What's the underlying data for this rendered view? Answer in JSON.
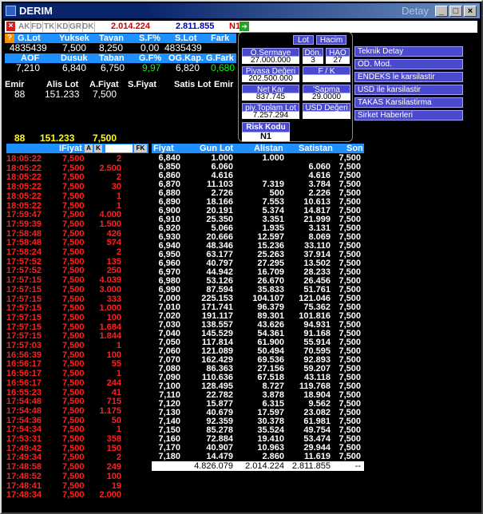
{
  "window": {
    "title": "DERIM",
    "right_label": "Detay"
  },
  "toolbar": {
    "tabs": [
      "AK",
      "FD",
      "TK",
      "KD",
      "GR",
      "DK"
    ],
    "value1": "2.014.224",
    "value2": "2.811.855",
    "n1": "N1"
  },
  "summary": {
    "row1_headers": [
      "G.Lot",
      "Yuksek",
      "Tavan",
      "S.F%",
      "S.Lot",
      "Fark"
    ],
    "row1_values": [
      "4835439",
      "7,500",
      "8,250",
      "0,00",
      "4835439",
      ""
    ],
    "row2_headers": [
      "AOF",
      "Dusuk",
      "Taban",
      "G.F%",
      "OG.Kap.",
      "G.Fark"
    ],
    "row2_values": [
      "7,210",
      "6,840",
      "6,750",
      "9,97",
      "6,820",
      "0,680"
    ],
    "row3_headers": [
      "Emir",
      "Alis Lot",
      "A.Fiyat",
      "S.Fiyat",
      "Satis Lot",
      "Emir"
    ],
    "row3_values": [
      "88",
      "151.233",
      "7,500",
      "",
      "",
      ""
    ],
    "row4_values": [
      "88",
      "151.233",
      "7,500"
    ]
  },
  "popup": {
    "lot_btn": "Lot",
    "hacim_btn": "Hacim",
    "osermaye_label": "Ö.Sermaye",
    "osermaye_value": "27.000.000",
    "don_label": "Dön.",
    "don_value": "3",
    "hao_label": "HAO",
    "hao_value": "27",
    "piyasa_label": "Piyasa Değeri",
    "piyasa_value": "202.500.000",
    "fk_label": "F / K",
    "fk_value": "",
    "netkar_label": "Net Kar",
    "netkar_value": "837.745",
    "sapma_label": "'Sapma",
    "sapma_value": "29.0000",
    "toplamlot_label": "piy.Toplam Lot",
    "toplamlot_value": "7.257.294",
    "usd_label": "USD Değeri",
    "usd_value": "",
    "risk_label": "Risk Kodu",
    "risk_value": "N1"
  },
  "menu": [
    "Teknik Detay",
    "OD. Mod.",
    "ENDEKS le karsilastir",
    "USD ile karsilastir",
    "TAKAS Karsilastirma",
    "Sirket Haberleri"
  ],
  "trades_header": {
    "fiyat": "IFiyat",
    "a": "A",
    "k": "K",
    "fk": "FK"
  },
  "trades": [
    [
      "18:05:22",
      "7,500",
      "2"
    ],
    [
      "18:05:22",
      "7,500",
      "2.500"
    ],
    [
      "18:05:22",
      "7,500",
      "2"
    ],
    [
      "18:05:22",
      "7,500",
      "30"
    ],
    [
      "18:05:22",
      "7,500",
      "1"
    ],
    [
      "18:05:22",
      "7,500",
      "1"
    ],
    [
      "17:59:47",
      "7,500",
      "4.000"
    ],
    [
      "17:59:39",
      "7,500",
      "1.500"
    ],
    [
      "17:58:48",
      "7,500",
      "426"
    ],
    [
      "17:58:48",
      "7,500",
      "574"
    ],
    [
      "17:58:24",
      "7,500",
      "2"
    ],
    [
      "17:57:52",
      "7,500",
      "135"
    ],
    [
      "17:57:52",
      "7,500",
      "250"
    ],
    [
      "17:57:15",
      "7,500",
      "4.039"
    ],
    [
      "17:57:15",
      "7,500",
      "3.000"
    ],
    [
      "17:57:15",
      "7,500",
      "333"
    ],
    [
      "17:57:15",
      "7,500",
      "1.000"
    ],
    [
      "17:57:15",
      "7,500",
      "100"
    ],
    [
      "17:57:15",
      "7,500",
      "1.684"
    ],
    [
      "17:57:15",
      "7,500",
      "1.844"
    ],
    [
      "17:57:03",
      "7,500",
      "1"
    ],
    [
      "16:56:39",
      "7,500",
      "100"
    ],
    [
      "16:56:17",
      "7,500",
      "55"
    ],
    [
      "16:56:17",
      "7,500",
      "1"
    ],
    [
      "16:56:17",
      "7,500",
      "244"
    ],
    [
      "16:55:23",
      "7,500",
      "41"
    ],
    [
      "17:54:48",
      "7,500",
      "715"
    ],
    [
      "17:54:48",
      "7,500",
      "1.175"
    ],
    [
      "17:54:36",
      "7,500",
      "50"
    ],
    [
      "17:54:34",
      "7,500",
      "1"
    ],
    [
      "17:53:31",
      "7,500",
      "358"
    ],
    [
      "17:49:42",
      "7,500",
      "150"
    ],
    [
      "17:49:34",
      "7,500",
      "2"
    ],
    [
      "17:48:58",
      "7,500",
      "249"
    ],
    [
      "17:48:52",
      "7,500",
      "100"
    ],
    [
      "17:48:41",
      "7,500",
      "19"
    ],
    [
      "17:48:34",
      "7,500",
      "2.000"
    ]
  ],
  "depth_header": {
    "fiyat": "Fiyat",
    "gun_lot": "Gun Lot",
    "alistan": "Alistan",
    "satistan": "Satistan",
    "son": "Son"
  },
  "depth": [
    [
      "6,840",
      "1.000",
      "1.000",
      "",
      "7,500"
    ],
    [
      "6,850",
      "6.060",
      "",
      "6.060",
      "7,500"
    ],
    [
      "6,860",
      "4.616",
      "",
      "4.616",
      "7,500"
    ],
    [
      "6,870",
      "11.103",
      "7.319",
      "3.784",
      "7,500"
    ],
    [
      "6,880",
      "2.726",
      "500",
      "2.226",
      "7,500"
    ],
    [
      "6,890",
      "18.166",
      "7.553",
      "10.613",
      "7,500"
    ],
    [
      "6,900",
      "20.191",
      "5.374",
      "14.817",
      "7,500"
    ],
    [
      "6,910",
      "25.350",
      "3.351",
      "21.999",
      "7,500"
    ],
    [
      "6,920",
      "5.066",
      "1.935",
      "3.131",
      "7,500"
    ],
    [
      "6,930",
      "20.666",
      "12.597",
      "8.069",
      "7,500"
    ],
    [
      "6,940",
      "48.346",
      "15.236",
      "33.110",
      "7,500"
    ],
    [
      "6,950",
      "63.177",
      "25.263",
      "37.914",
      "7,500"
    ],
    [
      "6,960",
      "40.797",
      "27.295",
      "13.502",
      "7,500"
    ],
    [
      "6,970",
      "44.942",
      "16.709",
      "28.233",
      "7,500"
    ],
    [
      "6,980",
      "53.126",
      "26.670",
      "26.456",
      "7,500"
    ],
    [
      "6,990",
      "87.594",
      "35.833",
      "51.761",
      "7,500"
    ],
    [
      "7,000",
      "225.153",
      "104.107",
      "121.046",
      "7,500"
    ],
    [
      "7,010",
      "171.741",
      "96.379",
      "75.362",
      "7,500"
    ],
    [
      "7,020",
      "191.117",
      "89.301",
      "101.816",
      "7,500"
    ],
    [
      "7,030",
      "138.557",
      "43.626",
      "94.931",
      "7,500"
    ],
    [
      "7,040",
      "145.529",
      "54.361",
      "91.168",
      "7,500"
    ],
    [
      "7,050",
      "117.814",
      "61.900",
      "55.914",
      "7,500"
    ],
    [
      "7,060",
      "121.089",
      "50.494",
      "70.595",
      "7,500"
    ],
    [
      "7,070",
      "162.429",
      "69.536",
      "92.893",
      "7,500"
    ],
    [
      "7,080",
      "86.363",
      "27.156",
      "59.207",
      "7,500"
    ],
    [
      "7,090",
      "110.636",
      "67.518",
      "43.118",
      "7,500"
    ],
    [
      "7,100",
      "128.495",
      "8.727",
      "119.768",
      "7,500"
    ],
    [
      "7,110",
      "22.782",
      "3.878",
      "18.904",
      "7,500"
    ],
    [
      "7,120",
      "15.877",
      "6.315",
      "9.562",
      "7,500"
    ],
    [
      "7,130",
      "40.679",
      "17.597",
      "23.082",
      "7,500"
    ],
    [
      "7,140",
      "92.359",
      "30.378",
      "61.981",
      "7,500"
    ],
    [
      "7,150",
      "85.278",
      "35.524",
      "49.754",
      "7,500"
    ],
    [
      "7,160",
      "72.884",
      "19.410",
      "53.474",
      "7,500"
    ],
    [
      "7,170",
      "40.907",
      "10.963",
      "29.944",
      "7,500"
    ],
    [
      "7,180",
      "14.479",
      "2.860",
      "11.619",
      "7,500"
    ]
  ],
  "depth_total": {
    "gun_lot": "4.826.079",
    "alistan": "2.014.224",
    "satistan": "2.811.855",
    "son": "--"
  }
}
